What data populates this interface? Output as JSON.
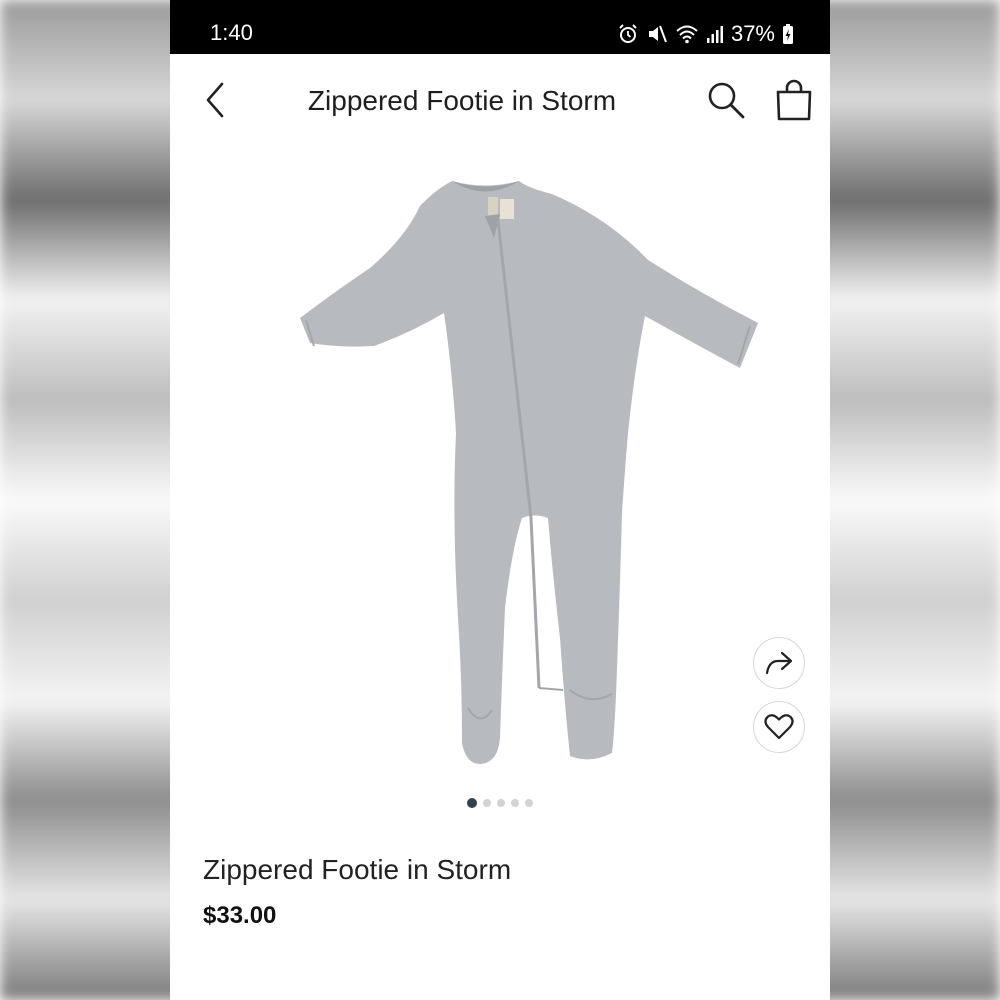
{
  "status_bar": {
    "time": "1:40",
    "battery": "37%",
    "icons": [
      "alarm-icon",
      "mute-icon",
      "wifi-icon",
      "signal-icon",
      "battery-charging-icon"
    ]
  },
  "header": {
    "title": "Zippered Footie in Storm",
    "back_icon": "chevron-left-icon",
    "search_icon": "search-icon",
    "bag_icon": "shopping-bag-icon"
  },
  "gallery": {
    "image_subject": "zippered footie",
    "total_images": 5,
    "active_index": 0,
    "actions": [
      "share-icon",
      "heart-icon"
    ]
  },
  "product": {
    "name": "Zippered Footie in Storm",
    "price": "$33.00"
  },
  "colors": {
    "status_bar_bg": "#000000",
    "page_bg": "#ffffff",
    "garment": "#b7babe",
    "active_dot": "#33414e",
    "inactive_dot": "#d2d2d2"
  }
}
